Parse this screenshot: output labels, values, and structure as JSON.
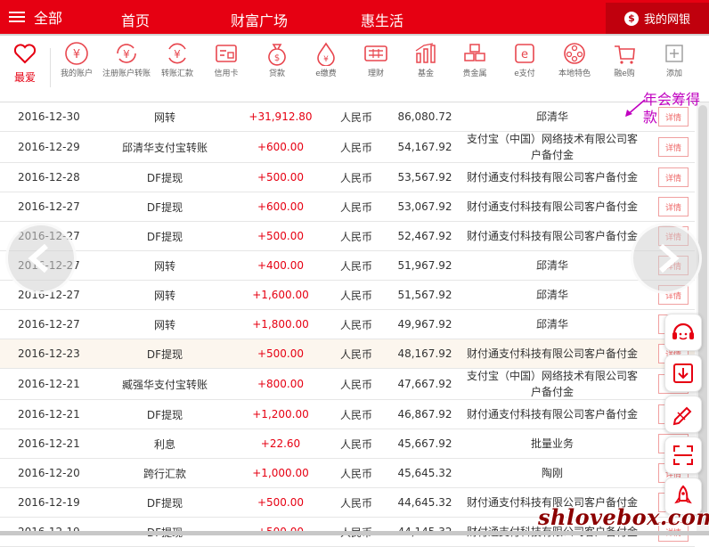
{
  "topbar": {
    "menu_label": "全部",
    "nav": [
      "首页",
      "财富广场",
      "惠生活"
    ],
    "mybank_label": "我的网银"
  },
  "icons": {
    "favorite_label": "最爱",
    "items": [
      {
        "label": "我的账户",
        "icon": "yuan-circle-icon"
      },
      {
        "label": "注册账户转账",
        "icon": "yuan-exchange-icon"
      },
      {
        "label": "转账汇款",
        "icon": "yuan-transfer-icon"
      },
      {
        "label": "信用卡",
        "icon": "credit-card-icon"
      },
      {
        "label": "贷款",
        "icon": "money-bag-icon"
      },
      {
        "label": "e缴费",
        "icon": "drop-icon"
      },
      {
        "label": "理财",
        "icon": "calculator-icon"
      },
      {
        "label": "基金",
        "icon": "bar-chart-icon"
      },
      {
        "label": "贵金属",
        "icon": "gold-bars-icon"
      },
      {
        "label": "e支付",
        "icon": "e-pay-icon"
      },
      {
        "label": "本地特色",
        "icon": "film-reel-icon"
      },
      {
        "label": "融e购",
        "icon": "shopping-icon"
      },
      {
        "label": "添加",
        "icon": "plus-box-icon"
      }
    ]
  },
  "annotation": "年会筹得款",
  "detail_label": "详情",
  "rows": [
    {
      "date": "2016-12-30",
      "desc": "网转",
      "amount": "+31,912.80",
      "currency": "人民币",
      "balance": "86,080.72",
      "counterparty": "邱清华"
    },
    {
      "date": "2016-12-29",
      "desc": "邱清华支付宝转账",
      "amount": "+600.00",
      "currency": "人民币",
      "balance": "54,167.92",
      "counterparty": "支付宝（中国）网络技术有限公司客户备付金"
    },
    {
      "date": "2016-12-28",
      "desc": "DF提现",
      "amount": "+500.00",
      "currency": "人民币",
      "balance": "53,567.92",
      "counterparty": "财付通支付科技有限公司客户备付金"
    },
    {
      "date": "2016-12-27",
      "desc": "DF提现",
      "amount": "+600.00",
      "currency": "人民币",
      "balance": "53,067.92",
      "counterparty": "财付通支付科技有限公司客户备付金"
    },
    {
      "date": "2016-12-27",
      "desc": "DF提现",
      "amount": "+500.00",
      "currency": "人民币",
      "balance": "52,467.92",
      "counterparty": "财付通支付科技有限公司客户备付金"
    },
    {
      "date": "2016-12-27",
      "desc": "网转",
      "amount": "+400.00",
      "currency": "人民币",
      "balance": "51,967.92",
      "counterparty": "邱清华"
    },
    {
      "date": "2016-12-27",
      "desc": "网转",
      "amount": "+1,600.00",
      "currency": "人民币",
      "balance": "51,567.92",
      "counterparty": "邱清华"
    },
    {
      "date": "2016-12-27",
      "desc": "网转",
      "amount": "+1,800.00",
      "currency": "人民币",
      "balance": "49,967.92",
      "counterparty": "邱清华"
    },
    {
      "date": "2016-12-23",
      "desc": "DF提现",
      "amount": "+500.00",
      "currency": "人民币",
      "balance": "48,167.92",
      "counterparty": "财付通支付科技有限公司客户备付金"
    },
    {
      "date": "2016-12-21",
      "desc": "臧强华支付宝转账",
      "amount": "+800.00",
      "currency": "人民币",
      "balance": "47,667.92",
      "counterparty": "支付宝（中国）网络技术有限公司客户备付金"
    },
    {
      "date": "2016-12-21",
      "desc": "DF提现",
      "amount": "+1,200.00",
      "currency": "人民币",
      "balance": "46,867.92",
      "counterparty": "财付通支付科技有限公司客户备付金"
    },
    {
      "date": "2016-12-21",
      "desc": "利息",
      "amount": "+22.60",
      "currency": "人民币",
      "balance": "45,667.92",
      "counterparty": "批量业务"
    },
    {
      "date": "2016-12-20",
      "desc": "跨行汇款",
      "amount": "+1,000.00",
      "currency": "人民币",
      "balance": "45,645.32",
      "counterparty": "陶刚"
    },
    {
      "date": "2016-12-19",
      "desc": "DF提现",
      "amount": "+500.00",
      "currency": "人民币",
      "balance": "44,645.32",
      "counterparty": "财付通支付科技有限公司客户备付金"
    },
    {
      "date": "2016-12-19",
      "desc": "DF提现",
      "amount": "+500.00",
      "currency": "人民币",
      "balance": "44,145.32",
      "counterparty": "财付通支付科技有限公司客户备付金"
    }
  ],
  "watermark": "shlovebox.com",
  "colors": {
    "brand": "#e60012",
    "annotation": "#c000c0"
  }
}
